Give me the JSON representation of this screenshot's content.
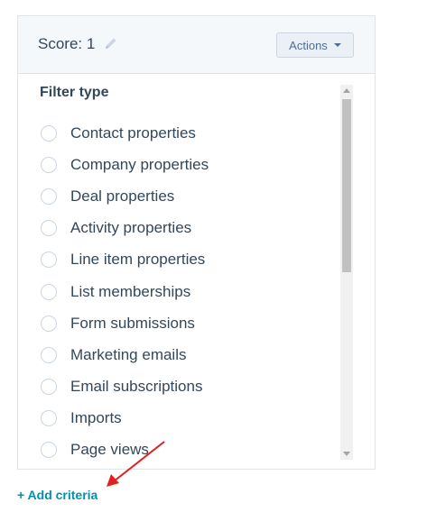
{
  "header": {
    "score_label": "Score: 1",
    "edit_icon": "pencil-icon",
    "actions_label": "Actions"
  },
  "filter": {
    "title": "Filter type",
    "options": [
      {
        "label": "Contact properties"
      },
      {
        "label": "Company properties"
      },
      {
        "label": "Deal properties"
      },
      {
        "label": "Activity properties"
      },
      {
        "label": "Line item properties"
      },
      {
        "label": "List memberships"
      },
      {
        "label": "Form submissions"
      },
      {
        "label": "Marketing emails"
      },
      {
        "label": "Email subscriptions"
      },
      {
        "label": "Imports"
      },
      {
        "label": "Page views"
      }
    ]
  },
  "footer": {
    "add_criteria_label": "+ Add criteria"
  },
  "annotation": {
    "arrow_color": "#e02020",
    "meaning": "arrow pointing to add-criteria link"
  },
  "colors": {
    "link": "#0091ae",
    "text": "#33475b",
    "header_bg": "#f5f8fa"
  }
}
